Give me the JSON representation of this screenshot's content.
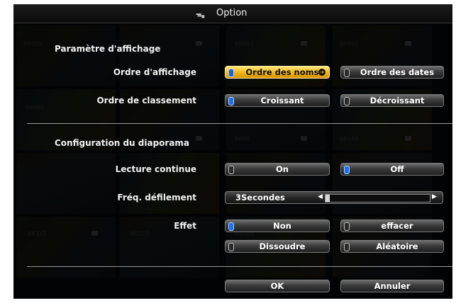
{
  "title": {
    "icon": "option-tool-icon",
    "text": "Option"
  },
  "background_thumbnails": {
    "numbers": [
      "00009",
      "00001",
      "00005",
      "00000",
      "0000",
      "00105",
      "00145",
      "00155",
      "00185"
    ]
  },
  "display_settings": {
    "heading": "Paramètre d'affichage",
    "order": {
      "label": "Ordre d'affichage",
      "options": [
        "Ordre des noms",
        "Ordre des dates"
      ],
      "selected": "Ordre des noms"
    },
    "sort": {
      "label": "Ordre de classement",
      "options": [
        "Croissant",
        "Décroissant"
      ],
      "selected": "Croissant"
    }
  },
  "slideshow": {
    "heading": "Configuration du diaporama",
    "continuous": {
      "label": "Lecture continue",
      "options": [
        "On",
        "Off"
      ],
      "selected": "Off"
    },
    "interval": {
      "label": "Fréq. défilement",
      "value": "3Secondes"
    },
    "effect": {
      "label": "Effet",
      "options": [
        "Non",
        "effacer",
        "Dissoudre",
        "Aléatoire"
      ],
      "selected": "Non"
    }
  },
  "footer": {
    "ok": "OK",
    "cancel": "Annuler"
  },
  "colors": {
    "selected_button": "#f0b514",
    "indicator_on": "#1d6ef0"
  }
}
